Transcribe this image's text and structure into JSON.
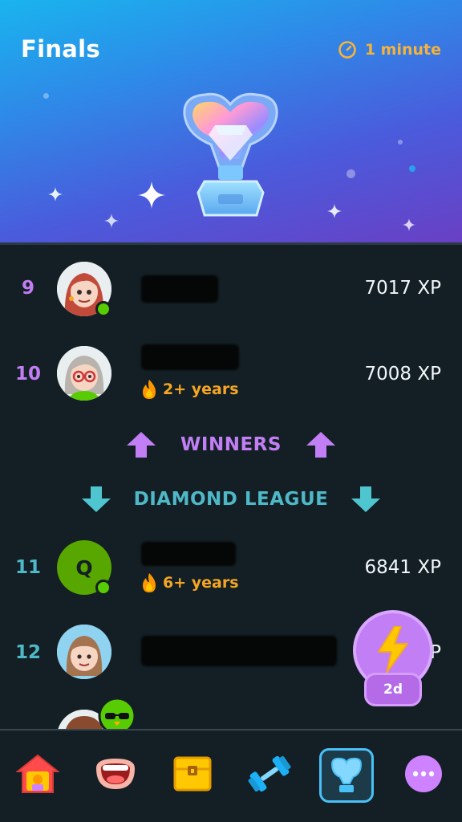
{
  "header": {
    "title": "Finals",
    "timer_label": "1 minute",
    "timer_icon": "stopwatch-icon",
    "trophy_icon": "diamond-trophy-icon"
  },
  "leaderboard": {
    "rows_top": [
      {
        "rank": "9",
        "xp": "7017 XP",
        "online": true,
        "streak": ""
      },
      {
        "rank": "10",
        "xp": "7008 XP",
        "online": false,
        "streak": "2+ years"
      }
    ],
    "winners_label": "WINNERS",
    "demotion_label": "DIAMOND LEAGUE",
    "rows_bottom": [
      {
        "rank": "11",
        "xp": "6841 XP",
        "online": true,
        "streak": "6+ years",
        "avatar_letter": "Q"
      },
      {
        "rank": "12",
        "xp": "P",
        "online": false,
        "streak": ""
      }
    ]
  },
  "floating": {
    "icon": "lightning-bolt-icon",
    "badge": "2d"
  },
  "nav": {
    "items": [
      "home-icon",
      "speaking-mouth-icon",
      "treasure-chest-icon",
      "dumbbell-icon",
      "leagues-icon",
      "more-icon"
    ],
    "active": "leagues-icon"
  },
  "colors": {
    "winners": "#c27ef5",
    "demotion": "#4fb8c8",
    "background": "#131f24",
    "streak": "#f5a623",
    "timer": "#f5b33a"
  }
}
